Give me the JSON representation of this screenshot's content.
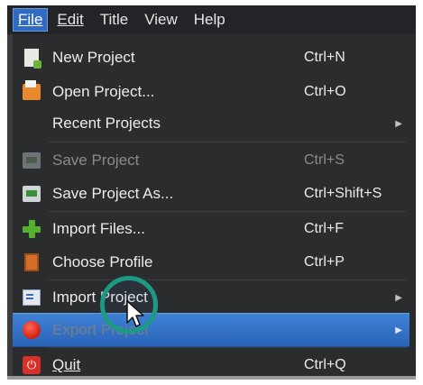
{
  "menubar": {
    "items": [
      {
        "label": "File",
        "active": true
      },
      {
        "label": "Edit",
        "active": false
      },
      {
        "label": "Title",
        "active": false
      },
      {
        "label": "View",
        "active": false
      },
      {
        "label": "Help",
        "active": false
      }
    ]
  },
  "file_menu": {
    "items": [
      {
        "label": "New Project",
        "shortcut": "Ctrl+N",
        "icon": "new-project-icon",
        "enabled": true
      },
      {
        "label": "Open Project...",
        "shortcut": "Ctrl+O",
        "icon": "folder-open-icon",
        "enabled": true
      },
      {
        "label": "Recent Projects",
        "shortcut": "",
        "icon": "",
        "enabled": true,
        "submenu": true
      },
      {
        "label": "Save Project",
        "shortcut": "Ctrl+S",
        "icon": "save-icon",
        "enabled": false
      },
      {
        "label": "Save Project As...",
        "shortcut": "Ctrl+Shift+S",
        "icon": "save-as-icon",
        "enabled": true
      },
      {
        "label": "Import Files...",
        "shortcut": "Ctrl+F",
        "icon": "plus-icon",
        "enabled": true
      },
      {
        "label": "Choose Profile",
        "shortcut": "Ctrl+P",
        "icon": "profile-icon",
        "enabled": true
      },
      {
        "label": "Import Project",
        "shortcut": "",
        "icon": "import-project-icon",
        "enabled": true,
        "submenu": true
      },
      {
        "label": "Export Project",
        "shortcut": "",
        "icon": "export-icon",
        "enabled": true,
        "submenu": true,
        "selected": true
      },
      {
        "label": "Quit",
        "shortcut": "Ctrl+Q",
        "icon": "quit-icon",
        "enabled": true
      }
    ]
  },
  "colors": {
    "menu_bg": "#2b2c2e",
    "highlight": "#2f6bc2",
    "cursor_ring": "#1d9a86"
  }
}
